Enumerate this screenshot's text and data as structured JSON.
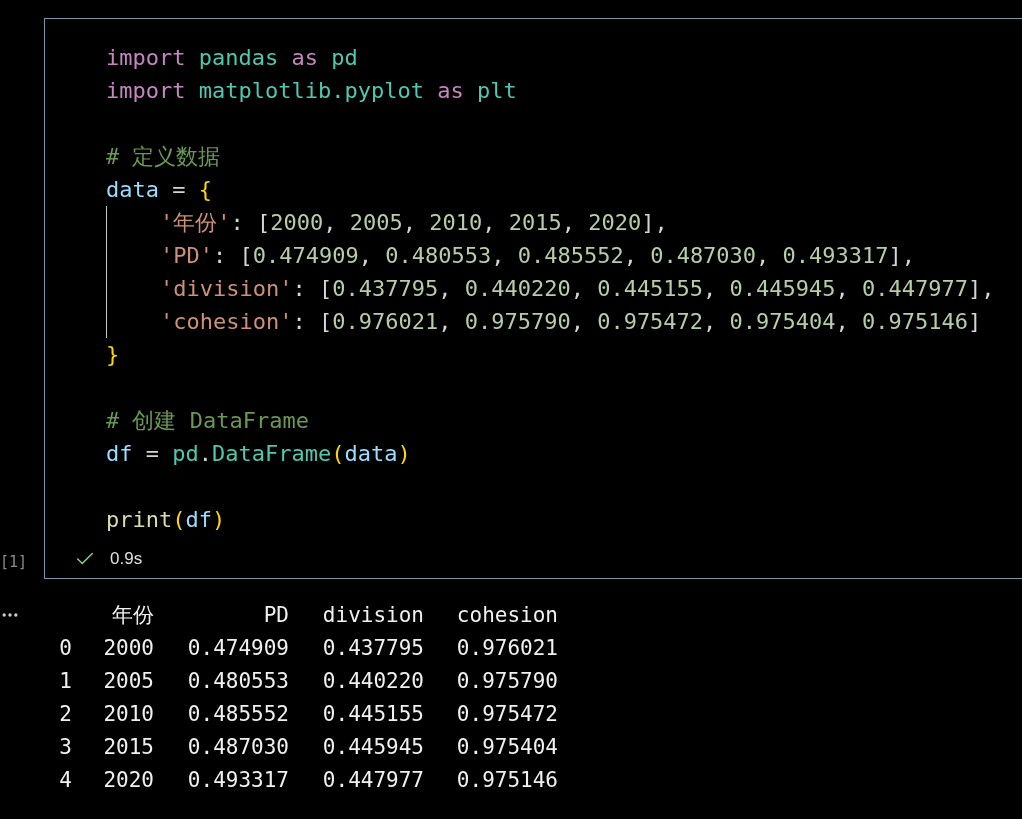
{
  "cell": {
    "execution_count": "[1]",
    "lines": [
      {
        "kind": "code",
        "tokens": [
          {
            "kind": "keyword",
            "text": "import "
          },
          {
            "kind": "module",
            "text": "pandas "
          },
          {
            "kind": "keyword",
            "text": "as "
          },
          {
            "kind": "module",
            "text": "pd"
          }
        ]
      },
      {
        "kind": "code",
        "tokens": [
          {
            "kind": "keyword",
            "text": "import "
          },
          {
            "kind": "module",
            "text": "matplotlib.pyplot "
          },
          {
            "kind": "keyword",
            "text": "as "
          },
          {
            "kind": "module",
            "text": "plt"
          }
        ]
      },
      {
        "kind": "blank"
      },
      {
        "kind": "code",
        "tokens": [
          {
            "kind": "comment",
            "text": "# 定义数据"
          }
        ]
      },
      {
        "kind": "code",
        "tokens": [
          {
            "kind": "variable",
            "text": "data"
          },
          {
            "kind": "plain",
            "text": " = "
          },
          {
            "kind": "bracket",
            "text": "{"
          }
        ],
        "children": [
          {
            "kind": "code",
            "tokens": [
              {
                "kind": "string",
                "text": "'年份'"
              },
              {
                "kind": "plain",
                "text": ": ["
              },
              {
                "kind": "number",
                "text": "2000"
              },
              {
                "kind": "plain",
                "text": ", "
              },
              {
                "kind": "number",
                "text": "2005"
              },
              {
                "kind": "plain",
                "text": ", "
              },
              {
                "kind": "number",
                "text": "2010"
              },
              {
                "kind": "plain",
                "text": ", "
              },
              {
                "kind": "number",
                "text": "2015"
              },
              {
                "kind": "plain",
                "text": ", "
              },
              {
                "kind": "number",
                "text": "2020"
              },
              {
                "kind": "plain",
                "text": "],"
              }
            ]
          },
          {
            "kind": "code",
            "tokens": [
              {
                "kind": "string",
                "text": "'PD'"
              },
              {
                "kind": "plain",
                "text": ": ["
              },
              {
                "kind": "number",
                "text": "0.474909"
              },
              {
                "kind": "plain",
                "text": ", "
              },
              {
                "kind": "number",
                "text": "0.480553"
              },
              {
                "kind": "plain",
                "text": ", "
              },
              {
                "kind": "number",
                "text": "0.485552"
              },
              {
                "kind": "plain",
                "text": ", "
              },
              {
                "kind": "number",
                "text": "0.487030"
              },
              {
                "kind": "plain",
                "text": ", "
              },
              {
                "kind": "number",
                "text": "0.493317"
              },
              {
                "kind": "plain",
                "text": "],"
              }
            ]
          },
          {
            "kind": "code",
            "tokens": [
              {
                "kind": "string",
                "text": "'division'"
              },
              {
                "kind": "plain",
                "text": ": ["
              },
              {
                "kind": "number",
                "text": "0.437795"
              },
              {
                "kind": "plain",
                "text": ", "
              },
              {
                "kind": "number",
                "text": "0.440220"
              },
              {
                "kind": "plain",
                "text": ", "
              },
              {
                "kind": "number",
                "text": "0.445155"
              },
              {
                "kind": "plain",
                "text": ", "
              },
              {
                "kind": "number",
                "text": "0.445945"
              },
              {
                "kind": "plain",
                "text": ", "
              },
              {
                "kind": "number",
                "text": "0.447977"
              },
              {
                "kind": "plain",
                "text": "],"
              }
            ]
          },
          {
            "kind": "code",
            "tokens": [
              {
                "kind": "string",
                "text": "'cohesion'"
              },
              {
                "kind": "plain",
                "text": ": ["
              },
              {
                "kind": "number",
                "text": "0.976021"
              },
              {
                "kind": "plain",
                "text": ", "
              },
              {
                "kind": "number",
                "text": "0.975790"
              },
              {
                "kind": "plain",
                "text": ", "
              },
              {
                "kind": "number",
                "text": "0.975472"
              },
              {
                "kind": "plain",
                "text": ", "
              },
              {
                "kind": "number",
                "text": "0.975404"
              },
              {
                "kind": "plain",
                "text": ", "
              },
              {
                "kind": "number",
                "text": "0.975146"
              },
              {
                "kind": "plain",
                "text": "]"
              }
            ]
          }
        ]
      },
      {
        "kind": "code",
        "tokens": [
          {
            "kind": "bracket",
            "text": "}"
          }
        ]
      },
      {
        "kind": "blank"
      },
      {
        "kind": "code",
        "tokens": [
          {
            "kind": "comment",
            "text": "# 创建 DataFrame"
          }
        ]
      },
      {
        "kind": "code",
        "tokens": [
          {
            "kind": "variable",
            "text": "df"
          },
          {
            "kind": "plain",
            "text": " = "
          },
          {
            "kind": "module",
            "text": "pd"
          },
          {
            "kind": "plain",
            "text": "."
          },
          {
            "kind": "module",
            "text": "DataFrame"
          },
          {
            "kind": "bracket",
            "text": "("
          },
          {
            "kind": "variable",
            "text": "data"
          },
          {
            "kind": "bracket",
            "text": ")"
          }
        ]
      },
      {
        "kind": "blank"
      },
      {
        "kind": "code",
        "tokens": [
          {
            "kind": "function",
            "text": "print"
          },
          {
            "kind": "bracket",
            "text": "("
          },
          {
            "kind": "variable",
            "text": "df"
          },
          {
            "kind": "bracket",
            "text": ")"
          }
        ]
      }
    ],
    "status": {
      "succeeded": true,
      "duration": "0.9s"
    }
  },
  "output": {
    "columns": [
      "年份",
      "PD",
      "division",
      "cohesion"
    ],
    "rows": [
      {
        "index": "0",
        "cells": [
          "2000",
          "0.474909",
          "0.437795",
          "0.976021"
        ]
      },
      {
        "index": "1",
        "cells": [
          "2005",
          "0.480553",
          "0.440220",
          "0.975790"
        ]
      },
      {
        "index": "2",
        "cells": [
          "2010",
          "0.485552",
          "0.445155",
          "0.975472"
        ]
      },
      {
        "index": "3",
        "cells": [
          "2015",
          "0.487030",
          "0.445945",
          "0.975404"
        ]
      },
      {
        "index": "4",
        "cells": [
          "2020",
          "0.493317",
          "0.447977",
          "0.975146"
        ]
      }
    ]
  }
}
